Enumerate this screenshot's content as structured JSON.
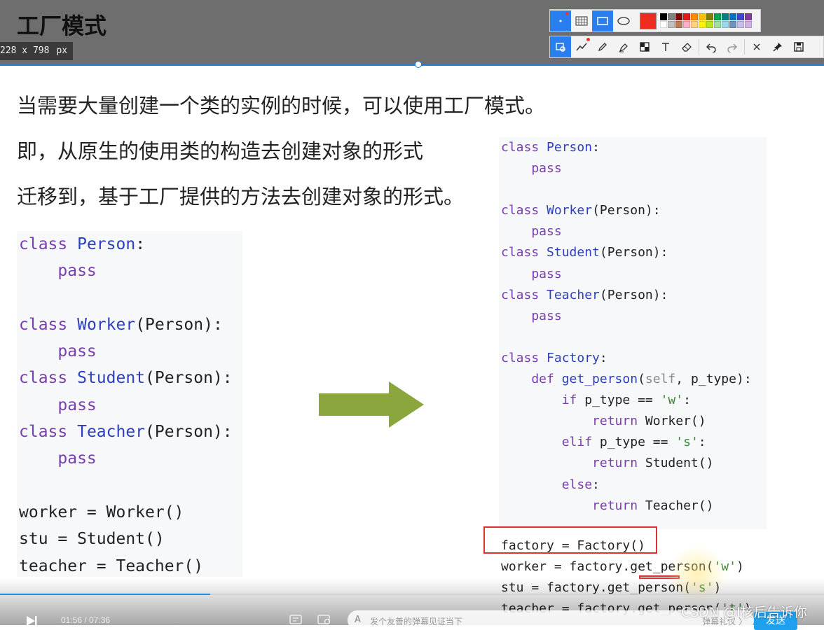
{
  "slide": {
    "title": "工厂模式",
    "lines": [
      "当需要大量创建一个类的实例的时候，可以使用工厂模式。",
      "即，从原生的使用类的构造去创建对象的形式",
      "迁移到，基于工厂提供的方法去创建对象的形式。"
    ]
  },
  "capture": {
    "size_text": "228 x 798",
    "unit": "px"
  },
  "toolbar": {
    "row1": [
      "mosaic-tool",
      "rectangle-tool",
      "ellipse-tool"
    ],
    "row2": [
      "shape-menu",
      "polyline-tool",
      "pen-tool",
      "marker-tool",
      "mosaic-tool",
      "text-tool",
      "eraser-tool",
      "undo",
      "redo",
      "close",
      "pin",
      "save"
    ],
    "current_color": "#ec2c21",
    "palette": [
      "#000000",
      "#808080",
      "#800000",
      "#e31a1c",
      "#ff8c00",
      "#ffc000",
      "#808000",
      "#00a650",
      "#008080",
      "#0070c0",
      "#3f48cc",
      "#7f3f98",
      "#ffffff",
      "#c0c0c0",
      "#b97a57",
      "#ffaec9",
      "#ffd280",
      "#fff200",
      "#b5e61d",
      "#a0e0a0",
      "#99d9ea",
      "#7092be",
      "#c8bfe7",
      "#d0b0e0"
    ]
  },
  "code_left": {
    "lines": [
      [
        {
          "t": "class ",
          "c": "kw"
        },
        {
          "t": "Person",
          "c": "cls"
        },
        {
          "t": ":",
          "c": ""
        }
      ],
      [
        {
          "t": "    pass",
          "c": "kw"
        }
      ],
      [],
      [
        {
          "t": "class ",
          "c": "kw"
        },
        {
          "t": "Worker",
          "c": "cls"
        },
        {
          "t": "(Person):",
          "c": ""
        }
      ],
      [
        {
          "t": "    pass",
          "c": "kw"
        }
      ],
      [
        {
          "t": "class ",
          "c": "kw"
        },
        {
          "t": "Student",
          "c": "cls"
        },
        {
          "t": "(Person):",
          "c": ""
        }
      ],
      [
        {
          "t": "    pass",
          "c": "kw"
        }
      ],
      [
        {
          "t": "class ",
          "c": "kw"
        },
        {
          "t": "Teacher",
          "c": "cls"
        },
        {
          "t": "(Person):",
          "c": ""
        }
      ],
      [
        {
          "t": "    pass",
          "c": "kw"
        }
      ],
      [],
      [
        {
          "t": "worker = Worker()",
          "c": ""
        }
      ],
      [
        {
          "t": "stu = Student()",
          "c": ""
        }
      ],
      [
        {
          "t": "teacher = Teacher()",
          "c": ""
        }
      ]
    ]
  },
  "code_right": {
    "lines": [
      [
        {
          "t": "class ",
          "c": "kw"
        },
        {
          "t": "Person",
          "c": "cls"
        },
        {
          "t": ":",
          "c": ""
        }
      ],
      [
        {
          "t": "    pass",
          "c": "kw"
        }
      ],
      [],
      [
        {
          "t": "class ",
          "c": "kw"
        },
        {
          "t": "Worker",
          "c": "cls"
        },
        {
          "t": "(Person):",
          "c": ""
        }
      ],
      [
        {
          "t": "    pass",
          "c": "kw"
        }
      ],
      [
        {
          "t": "class ",
          "c": "kw"
        },
        {
          "t": "Student",
          "c": "cls"
        },
        {
          "t": "(Person):",
          "c": ""
        }
      ],
      [
        {
          "t": "    pass",
          "c": "kw"
        }
      ],
      [
        {
          "t": "class ",
          "c": "kw"
        },
        {
          "t": "Teacher",
          "c": "cls"
        },
        {
          "t": "(Person):",
          "c": ""
        }
      ],
      [
        {
          "t": "    pass",
          "c": "kw"
        }
      ],
      [],
      [
        {
          "t": "class ",
          "c": "kw"
        },
        {
          "t": "Factory",
          "c": "cls"
        },
        {
          "t": ":",
          "c": ""
        }
      ],
      [
        {
          "t": "    def ",
          "c": "kw"
        },
        {
          "t": "get_person",
          "c": "cls"
        },
        {
          "t": "(",
          "c": ""
        },
        {
          "t": "self",
          "c": "self"
        },
        {
          "t": ", p_type):",
          "c": ""
        }
      ],
      [
        {
          "t": "        if ",
          "c": "kw"
        },
        {
          "t": "p_type == ",
          "c": ""
        },
        {
          "t": "'w'",
          "c": "str"
        },
        {
          "t": ":",
          "c": ""
        }
      ],
      [
        {
          "t": "            return ",
          "c": "kw"
        },
        {
          "t": "Worker()",
          "c": ""
        }
      ],
      [
        {
          "t": "        elif ",
          "c": "kw"
        },
        {
          "t": "p_type == ",
          "c": ""
        },
        {
          "t": "'s'",
          "c": "str"
        },
        {
          "t": ":",
          "c": ""
        }
      ],
      [
        {
          "t": "            return ",
          "c": "kw"
        },
        {
          "t": "Student()",
          "c": ""
        }
      ],
      [
        {
          "t": "        else",
          "c": "kw"
        },
        {
          "t": ":",
          "c": ""
        }
      ],
      [
        {
          "t": "            return ",
          "c": "kw"
        },
        {
          "t": "Teacher()",
          "c": ""
        }
      ]
    ],
    "usage": [
      [
        {
          "t": "factory = Factory()",
          "c": ""
        }
      ],
      [
        {
          "t": "worker = factory.get_person(",
          "c": ""
        },
        {
          "t": "'w'",
          "c": "str"
        },
        {
          "t": ")",
          "c": ""
        }
      ],
      [
        {
          "t": "stu = factory.get_person(",
          "c": ""
        },
        {
          "t": "'s'",
          "c": "str"
        },
        {
          "t": ")",
          "c": ""
        }
      ],
      [
        {
          "t": "teacher = factory.get_person(",
          "c": ""
        },
        {
          "t": "'t'",
          "c": "str"
        },
        {
          "t": ")",
          "c": ""
        }
      ]
    ]
  },
  "player": {
    "time_current": "01:56",
    "time_total": "07:36",
    "progress_fraction": 0.255,
    "danmaku_placeholder": "发个友善的弹幕见证当下",
    "etiquette": "弹幕礼仪 〉",
    "send_label": "发送",
    "watermark": "CSDN @I核后告诉你"
  },
  "colors": {
    "arrow": "#8aa63c",
    "highlight": "#dd3333",
    "accent": "#1e7bd9"
  }
}
